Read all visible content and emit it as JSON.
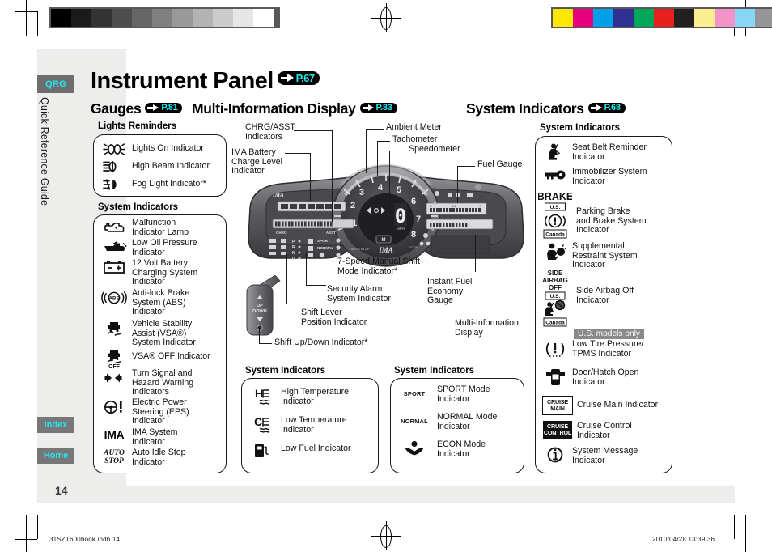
{
  "document": {
    "title": "Instrument Panel",
    "title_page_ref": "P.67",
    "page_number": "14",
    "sidebar": {
      "tab_label": "QRG",
      "vertical_label": "Quick Reference Guide",
      "index_label": "Index",
      "home_label": "Home"
    },
    "footer": {
      "file_name": "31SZT600book.indb   14",
      "timestamp": "2010/04/28   13:39:36"
    }
  },
  "sections": [
    {
      "name": "gauges",
      "title": "Gauges",
      "page_ref": "P.81"
    },
    {
      "name": "mid",
      "title": "Multi-Information Display",
      "page_ref": "P.83"
    },
    {
      "name": "sysind",
      "title": "System Indicators",
      "page_ref": "P.68"
    }
  ],
  "lights_reminders": {
    "heading": "Lights Reminders",
    "items": [
      {
        "icon": "lights-on-icon",
        "label": "Lights On Indicator"
      },
      {
        "icon": "high-beam-icon",
        "label": "High Beam Indicator"
      },
      {
        "icon": "fog-light-icon",
        "label": "Fog Light Indicator*"
      }
    ]
  },
  "left_system_indicators": {
    "heading": "System Indicators",
    "items": [
      {
        "icon": "engine-malfunction-icon",
        "label": "Malfunction\nIndicator Lamp"
      },
      {
        "icon": "oil-can-icon",
        "label": "Low Oil Pressure\nIndicator"
      },
      {
        "icon": "battery-icon",
        "label": "12 Volt Battery\nCharging System\nIndicator"
      },
      {
        "icon": "abs-icon",
        "label": "Anti-lock Brake\nSystem (ABS)\nIndicator"
      },
      {
        "icon": "vsa-icon",
        "label": "Vehicle Stability\nAssist (VSA®)\nSystem Indicator"
      },
      {
        "icon": "vsa-off-icon",
        "label": "VSA® OFF Indicator"
      },
      {
        "icon": "turn-signal-icon",
        "label": "Turn Signal and\nHazard Warning\nIndicators"
      },
      {
        "icon": "eps-icon",
        "label": "Electric Power\nSteering (EPS)\nIndicator"
      },
      {
        "icon": "ima-icon",
        "label": "IMA System\nIndicator"
      },
      {
        "icon": "auto-idle-stop-icon",
        "label": "Auto Idle Stop\nIndicator"
      }
    ]
  },
  "temp_fuel_indicators": {
    "heading": "System Indicators",
    "items": [
      {
        "icon": "high-temperature-icon",
        "label": "High Temperature\nIndicator"
      },
      {
        "icon": "low-temperature-icon",
        "label": "Low Temperature\nIndicator"
      },
      {
        "icon": "low-fuel-icon",
        "label": "Low Fuel Indicator"
      }
    ]
  },
  "mode_indicators": {
    "heading": "System Indicators",
    "items": [
      {
        "icon": "sport-mode-icon",
        "icon_text": "SPORT",
        "label": "SPORT Mode\nIndicator"
      },
      {
        "icon": "normal-mode-icon",
        "icon_text": "NORMAL",
        "label": "NORMAL Mode\nIndicator"
      },
      {
        "icon": "econ-mode-icon",
        "icon_text": "",
        "label": "ECON Mode\nIndicator"
      }
    ]
  },
  "right_system_indicators": {
    "heading": "System Indicators",
    "badge": "U.S. models only",
    "items": [
      {
        "icon": "seat-belt-reminder-icon",
        "label": "Seat Belt Reminder\nIndicator"
      },
      {
        "icon": "immobilizer-key-icon",
        "label": "Immobilizer System\nIndicator"
      },
      {
        "icon": "parking-brake-icon",
        "label": "Parking Brake\nand Brake System\nIndicator",
        "icon_text_us": "BRAKE",
        "region_us": "U.S.",
        "region_canada": "Canada"
      },
      {
        "icon": "srs-airbag-icon",
        "label": "Supplemental\nRestraint System\nIndicator"
      },
      {
        "icon": "side-airbag-off-icon",
        "label": "Side Airbag Off\nIndicator",
        "icon_text_us": "SIDE\nAIRBAG\nOFF",
        "region_us": "U.S.",
        "region_canada": "Canada"
      },
      {
        "icon": "low-tire-pressure-icon",
        "label": "Low Tire Pressure/\nTPMS Indicator"
      },
      {
        "icon": "door-hatch-open-icon",
        "label": "Door/Hatch Open\nIndicator"
      },
      {
        "icon": "cruise-main-icon",
        "icon_text": "CRUISE\nMAIN",
        "label": "Cruise Main Indicator"
      },
      {
        "icon": "cruise-control-icon",
        "icon_text": "CRUISE\nCONTROL",
        "label": "Cruise Control\nIndicator"
      },
      {
        "icon": "info-icon",
        "label": "System Message\nIndicator"
      }
    ]
  },
  "cluster_callouts": [
    {
      "name": "chrg-asst",
      "label": "CHRG/ASST\nIndicators"
    },
    {
      "name": "ima-battery-charge",
      "label": "IMA Battery\nCharge Level\nIndicator"
    },
    {
      "name": "ambient-meter",
      "label": "Ambient Meter"
    },
    {
      "name": "tachometer",
      "label": "Tachometer"
    },
    {
      "name": "speedometer",
      "label": "Speedometer"
    },
    {
      "name": "fuel-gauge",
      "label": "Fuel Gauge"
    },
    {
      "name": "manual-shift-mode",
      "label": "7-Speed Manual Shift\nMode Indicator*"
    },
    {
      "name": "security-alarm",
      "label": "Security Alarm\nSystem Indicator"
    },
    {
      "name": "shift-lever-position",
      "label": "Shift Lever\nPosition Indicator"
    },
    {
      "name": "shift-up-down",
      "label": "Shift Up/Down Indicator*"
    },
    {
      "name": "instant-fuel-economy",
      "label": "Instant Fuel\nEconomy\nGauge"
    },
    {
      "name": "multi-info-display",
      "label": "Multi-Information\nDisplay"
    }
  ],
  "cluster_face": {
    "tach_numbers": [
      "1",
      "2",
      "3",
      "4",
      "5",
      "6",
      "7",
      "8"
    ],
    "speed_digit": "0",
    "unit_label": "MPH",
    "chrg_label": "CHRG",
    "asst_label": "ASST",
    "ima_label": "IMA",
    "shift_positions": [
      "P",
      "R",
      "N",
      "D"
    ],
    "mode_sport": "SPORT",
    "mode_normal": "NORMAL",
    "shift_lever_up": "UP",
    "shift_lever_down": "DOWN"
  },
  "colors": {
    "cyan_accent": "#22e8ee",
    "tab_grey": "#6e6e70",
    "page_bg": "#ededec",
    "badge_grey": "#8a8a8c",
    "cluster_dark": "#3d3d3f"
  },
  "print_marks": {
    "grey_steps": [
      "#000000",
      "#1a1a1a",
      "#333333",
      "#4d4d4d",
      "#666666",
      "#808080",
      "#999999",
      "#b3b3b3",
      "#cccccc",
      "#e6e6e6",
      "#ffffff"
    ],
    "color_swatches": [
      "#ffe800",
      "#e6007e",
      "#00a0e9",
      "#2e3192",
      "#00a65a",
      "#e8201e",
      "#231f20",
      "#fbee91",
      "#f493c8",
      "#87d6f5",
      "#939598"
    ]
  }
}
